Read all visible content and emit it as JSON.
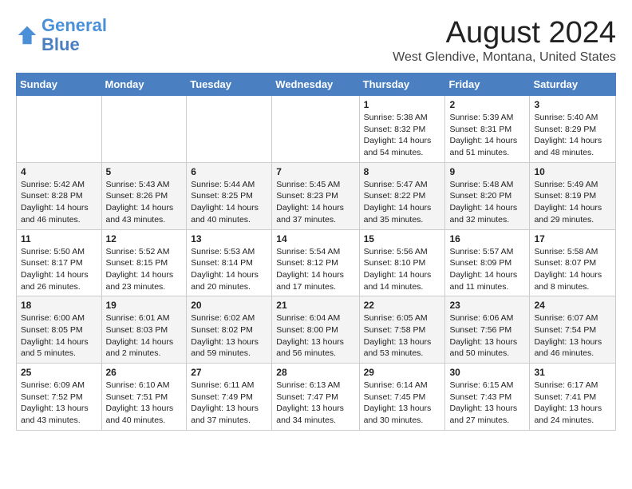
{
  "header": {
    "logo_line1": "General",
    "logo_line2": "Blue",
    "month_title": "August 2024",
    "location": "West Glendive, Montana, United States"
  },
  "weekdays": [
    "Sunday",
    "Monday",
    "Tuesday",
    "Wednesday",
    "Thursday",
    "Friday",
    "Saturday"
  ],
  "weeks": [
    [
      {
        "day": "",
        "info": ""
      },
      {
        "day": "",
        "info": ""
      },
      {
        "day": "",
        "info": ""
      },
      {
        "day": "",
        "info": ""
      },
      {
        "day": "1",
        "info": "Sunrise: 5:38 AM\nSunset: 8:32 PM\nDaylight: 14 hours\nand 54 minutes."
      },
      {
        "day": "2",
        "info": "Sunrise: 5:39 AM\nSunset: 8:31 PM\nDaylight: 14 hours\nand 51 minutes."
      },
      {
        "day": "3",
        "info": "Sunrise: 5:40 AM\nSunset: 8:29 PM\nDaylight: 14 hours\nand 48 minutes."
      }
    ],
    [
      {
        "day": "4",
        "info": "Sunrise: 5:42 AM\nSunset: 8:28 PM\nDaylight: 14 hours\nand 46 minutes."
      },
      {
        "day": "5",
        "info": "Sunrise: 5:43 AM\nSunset: 8:26 PM\nDaylight: 14 hours\nand 43 minutes."
      },
      {
        "day": "6",
        "info": "Sunrise: 5:44 AM\nSunset: 8:25 PM\nDaylight: 14 hours\nand 40 minutes."
      },
      {
        "day": "7",
        "info": "Sunrise: 5:45 AM\nSunset: 8:23 PM\nDaylight: 14 hours\nand 37 minutes."
      },
      {
        "day": "8",
        "info": "Sunrise: 5:47 AM\nSunset: 8:22 PM\nDaylight: 14 hours\nand 35 minutes."
      },
      {
        "day": "9",
        "info": "Sunrise: 5:48 AM\nSunset: 8:20 PM\nDaylight: 14 hours\nand 32 minutes."
      },
      {
        "day": "10",
        "info": "Sunrise: 5:49 AM\nSunset: 8:19 PM\nDaylight: 14 hours\nand 29 minutes."
      }
    ],
    [
      {
        "day": "11",
        "info": "Sunrise: 5:50 AM\nSunset: 8:17 PM\nDaylight: 14 hours\nand 26 minutes."
      },
      {
        "day": "12",
        "info": "Sunrise: 5:52 AM\nSunset: 8:15 PM\nDaylight: 14 hours\nand 23 minutes."
      },
      {
        "day": "13",
        "info": "Sunrise: 5:53 AM\nSunset: 8:14 PM\nDaylight: 14 hours\nand 20 minutes."
      },
      {
        "day": "14",
        "info": "Sunrise: 5:54 AM\nSunset: 8:12 PM\nDaylight: 14 hours\nand 17 minutes."
      },
      {
        "day": "15",
        "info": "Sunrise: 5:56 AM\nSunset: 8:10 PM\nDaylight: 14 hours\nand 14 minutes."
      },
      {
        "day": "16",
        "info": "Sunrise: 5:57 AM\nSunset: 8:09 PM\nDaylight: 14 hours\nand 11 minutes."
      },
      {
        "day": "17",
        "info": "Sunrise: 5:58 AM\nSunset: 8:07 PM\nDaylight: 14 hours\nand 8 minutes."
      }
    ],
    [
      {
        "day": "18",
        "info": "Sunrise: 6:00 AM\nSunset: 8:05 PM\nDaylight: 14 hours\nand 5 minutes."
      },
      {
        "day": "19",
        "info": "Sunrise: 6:01 AM\nSunset: 8:03 PM\nDaylight: 14 hours\nand 2 minutes."
      },
      {
        "day": "20",
        "info": "Sunrise: 6:02 AM\nSunset: 8:02 PM\nDaylight: 13 hours\nand 59 minutes."
      },
      {
        "day": "21",
        "info": "Sunrise: 6:04 AM\nSunset: 8:00 PM\nDaylight: 13 hours\nand 56 minutes."
      },
      {
        "day": "22",
        "info": "Sunrise: 6:05 AM\nSunset: 7:58 PM\nDaylight: 13 hours\nand 53 minutes."
      },
      {
        "day": "23",
        "info": "Sunrise: 6:06 AM\nSunset: 7:56 PM\nDaylight: 13 hours\nand 50 minutes."
      },
      {
        "day": "24",
        "info": "Sunrise: 6:07 AM\nSunset: 7:54 PM\nDaylight: 13 hours\nand 46 minutes."
      }
    ],
    [
      {
        "day": "25",
        "info": "Sunrise: 6:09 AM\nSunset: 7:52 PM\nDaylight: 13 hours\nand 43 minutes."
      },
      {
        "day": "26",
        "info": "Sunrise: 6:10 AM\nSunset: 7:51 PM\nDaylight: 13 hours\nand 40 minutes."
      },
      {
        "day": "27",
        "info": "Sunrise: 6:11 AM\nSunset: 7:49 PM\nDaylight: 13 hours\nand 37 minutes."
      },
      {
        "day": "28",
        "info": "Sunrise: 6:13 AM\nSunset: 7:47 PM\nDaylight: 13 hours\nand 34 minutes."
      },
      {
        "day": "29",
        "info": "Sunrise: 6:14 AM\nSunset: 7:45 PM\nDaylight: 13 hours\nand 30 minutes."
      },
      {
        "day": "30",
        "info": "Sunrise: 6:15 AM\nSunset: 7:43 PM\nDaylight: 13 hours\nand 27 minutes."
      },
      {
        "day": "31",
        "info": "Sunrise: 6:17 AM\nSunset: 7:41 PM\nDaylight: 13 hours\nand 24 minutes."
      }
    ]
  ]
}
